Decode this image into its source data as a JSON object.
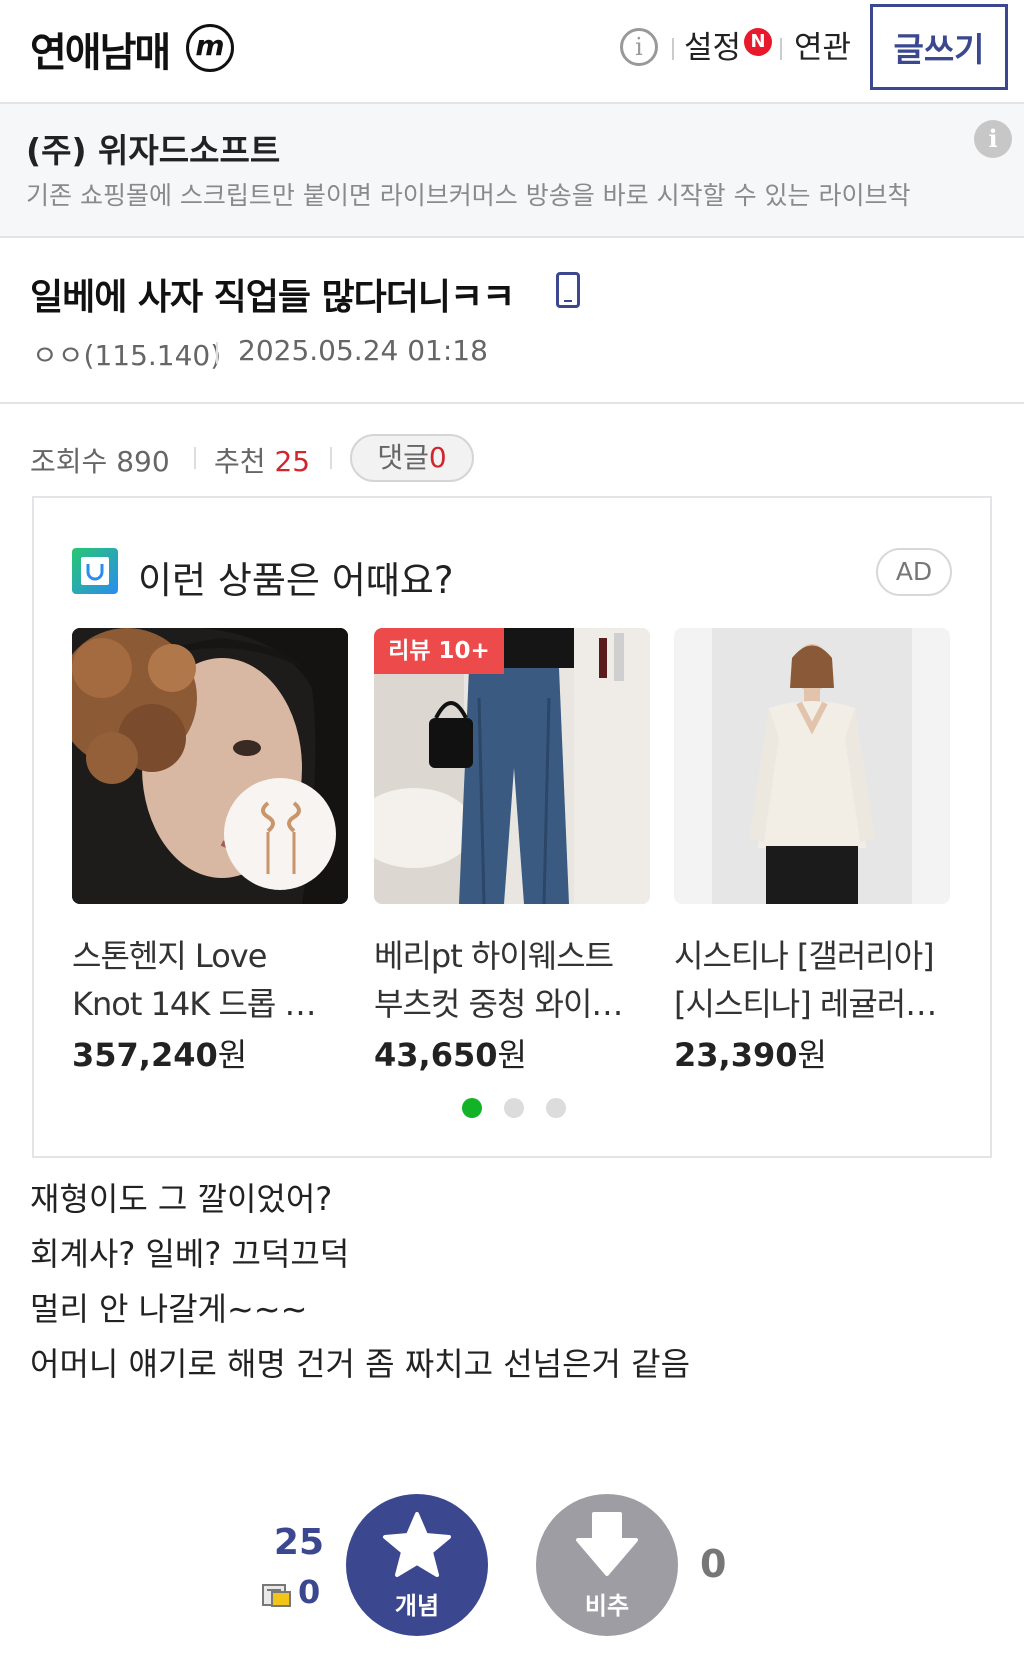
{
  "header": {
    "logo": "연애남매",
    "logo_mark": "m",
    "info_icon": "info-icon",
    "settings_label": "설정",
    "new_badge": "N",
    "related_label": "연관",
    "write_label": "글쓰기"
  },
  "banner": {
    "title": "(주) 위자드소프트",
    "description": "기존 쇼핑몰에 스크립트만 붙이면 라이브커머스 방송을 바로 시작할 수 있는 라이브착",
    "info_icon": "info-icon"
  },
  "post": {
    "title": "일베에 사자 직업들 많다더니ㅋㅋ",
    "author": "ㅇㅇ(115.140)",
    "date": "2025.05.24 01:18",
    "device_icon": "mobile-icon"
  },
  "stats": {
    "views_label": "조회수",
    "views": "890",
    "recommend_label": "추천",
    "recommend": "25",
    "comments_label": "댓글",
    "comments": "0"
  },
  "ad": {
    "heading": "이런 상품은 어때요?",
    "badge": "AD",
    "products": [
      {
        "name_line1": "스톤헨지 Love",
        "name_line2": "Knot 14K 드롭 …",
        "price": "357,240",
        "unit": "원",
        "tag": ""
      },
      {
        "name_line1": "베리pt 하이웨스트",
        "name_line2": "부츠컷 중청 와이…",
        "price": "43,650",
        "unit": "원",
        "tag": "리뷰 10+"
      },
      {
        "name_line1": "시스티나 [갤러리아]",
        "name_line2": "[시스티나] 레귤러…",
        "price": "23,390",
        "unit": "원",
        "tag": ""
      }
    ],
    "page_index": 1,
    "page_count": 3
  },
  "content": {
    "lines": [
      "재형이도 그 깔이었어?",
      "회계사? 일베? 끄덕끄덕",
      "멀리 안 나갈게~~~",
      "어머니 얘기로 해명 건거 좀 짜치고 선넘은거 같음"
    ]
  },
  "votes": {
    "up_count": "25",
    "fix_count": "0",
    "up_label": "개념",
    "down_label": "비추",
    "down_count": "0"
  },
  "colors": {
    "brand": "#3b4890",
    "accent_red": "#d0272f",
    "dot_active": "#12b327",
    "downvote": "#9d9da3"
  }
}
